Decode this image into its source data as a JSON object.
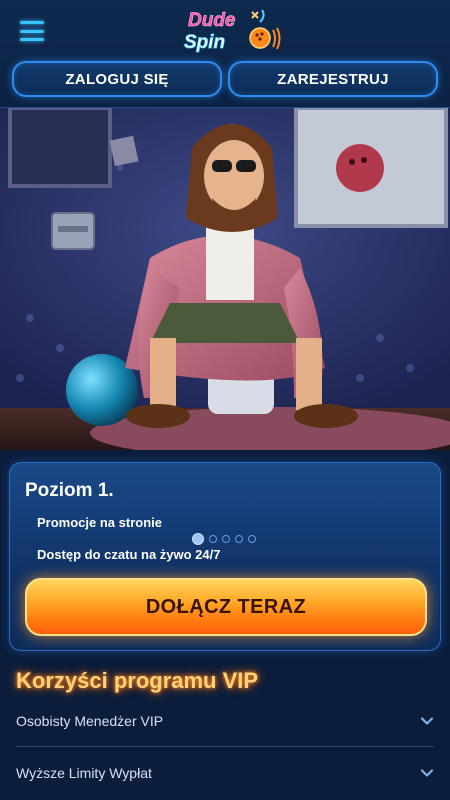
{
  "header": {
    "logo_line1": "Dude",
    "logo_line2": "Spin",
    "login_label": "ZALOGUJ SIĘ",
    "register_label": "ZAREJESTRUJ"
  },
  "level_card": {
    "title": "Poziom 1.",
    "benefits": [
      "Promocje na stronie",
      "Dostęp do czatu na żywo 24/7"
    ],
    "slides_total": 5,
    "slide_active": 1,
    "join_label": "DOŁĄCZ TERAZ"
  },
  "vip": {
    "title": "Korzyści programu VIP",
    "items": [
      {
        "label": "Osobisty Menedżer VIP"
      },
      {
        "label": "Wyższe Limity Wypłat"
      }
    ]
  },
  "icons": {
    "menu": "hamburger-menu-icon",
    "expand": "chevron-down-icon"
  },
  "colors": {
    "accent_blue": "#39c3ff",
    "button_orange": "#ff7a10",
    "vip_title": "#ffd27a",
    "background": "#0b1d3a"
  }
}
